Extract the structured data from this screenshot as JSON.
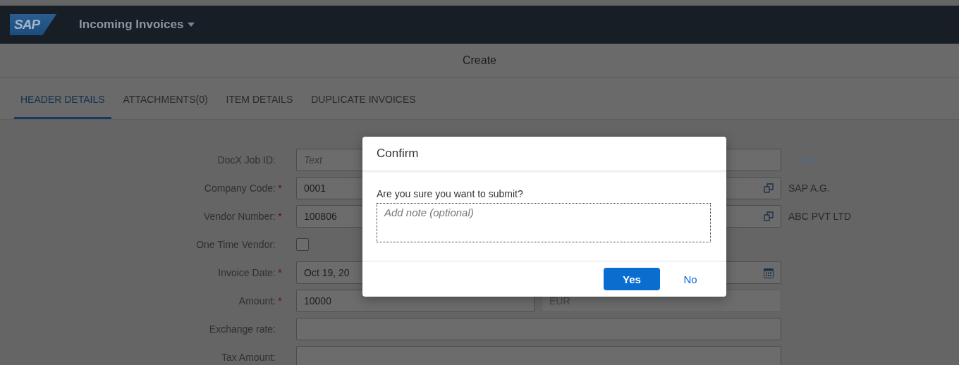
{
  "shell": {
    "logo": "SAP",
    "app_title": "Incoming Invoices"
  },
  "page": {
    "title": "Create"
  },
  "tabs": [
    {
      "label": "HEADER DETAILS",
      "selected": true
    },
    {
      "label": "ATTACHMENTS(0)",
      "selected": false
    },
    {
      "label": "ITEM DETAILS",
      "selected": false
    },
    {
      "label": "DUPLICATE INVOICES",
      "selected": false
    }
  ],
  "form": [
    {
      "kind": "lookup",
      "label": "DocX Job ID:",
      "placeholder": "Text"
    },
    {
      "kind": "valuehelp",
      "label": "Company Code:",
      "required_mark": "*",
      "value": "0001",
      "description": "SAP A.G."
    },
    {
      "kind": "valuehelp",
      "label": "Vendor Number:",
      "required_mark": "*",
      "value": "100806",
      "description": "ABC PVT LTD"
    },
    {
      "kind": "checkbox",
      "label": "One Time Vendor:",
      "checked": false
    },
    {
      "kind": "date",
      "label": "Invoice Date:",
      "required_mark": "*",
      "value": "Oct 19, 20"
    },
    {
      "kind": "amount",
      "label": "Amount:",
      "required_mark": "*",
      "value": "10000",
      "currency": "EUR"
    },
    {
      "kind": "input",
      "label": "Exchange rate:"
    },
    {
      "kind": "input",
      "label": "Tax Amount:"
    }
  ],
  "dialog": {
    "title": "Confirm",
    "message": "Are you sure you want to submit?",
    "note_placeholder": "Add note (optional)",
    "buttons": [
      {
        "label": "Yes",
        "kind": "primary"
      },
      {
        "label": "No",
        "kind": "transparent"
      }
    ]
  }
}
